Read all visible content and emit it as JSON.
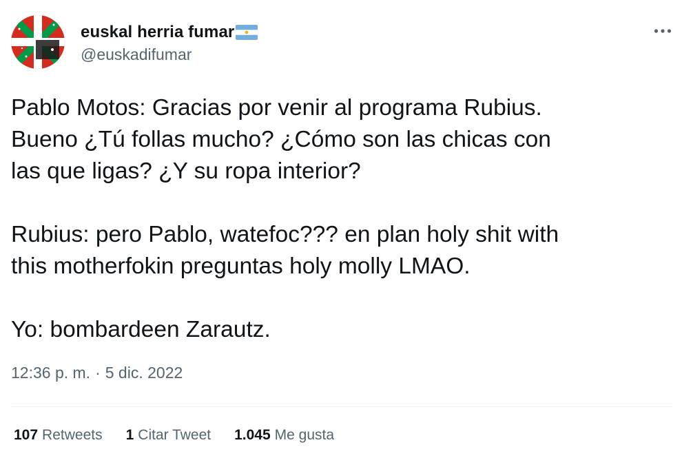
{
  "author": {
    "display_name": "euskal herria fumar",
    "flag_icon": "argentina-flag-icon",
    "handle": "@euskadifumar",
    "avatar_icon": "ikurrina-avatar"
  },
  "tweet": {
    "paragraphs": [
      "Pablo Motos: Gracias por venir al programa Rubius.\nBueno ¿Tú follas mucho? ¿Cómo son las chicas con\nlas que ligas? ¿Y su ropa interior?",
      "Rubius: pero Pablo, watefoc??? en plan holy shit with\nthis motherfokin preguntas holy molly LMAO.",
      "Yo: bombardeen Zarautz."
    ]
  },
  "meta": {
    "time": "12:36 p. m.",
    "separator": "·",
    "date": "5 dic. 2022"
  },
  "stats": {
    "retweets_count": "107",
    "retweets_label": "Retweets",
    "quotes_count": "1",
    "quotes_label": "Citar Tweet",
    "likes_count": "1.045",
    "likes_label": "Me gusta"
  },
  "colors": {
    "text_primary": "#0f1419",
    "text_secondary": "#536471",
    "divider": "#eff3f4"
  }
}
